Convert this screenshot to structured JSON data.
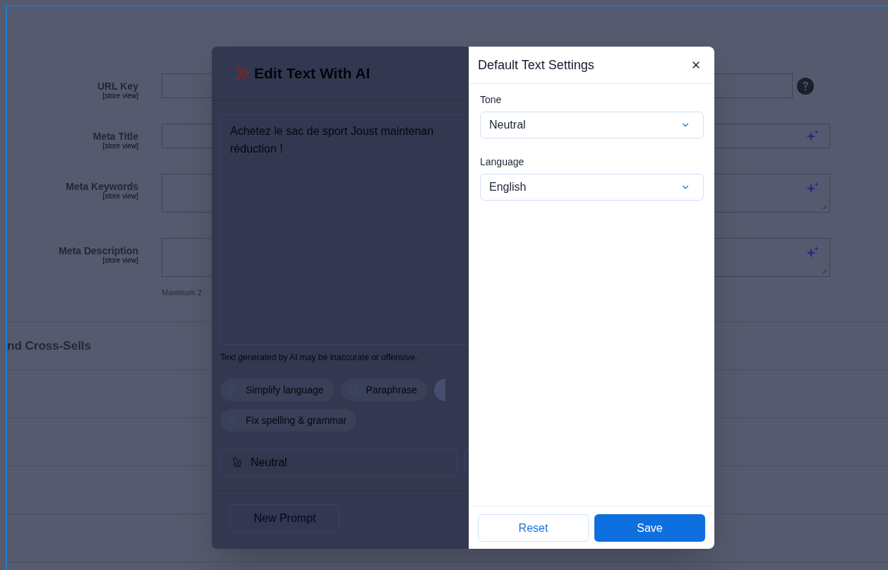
{
  "page": {
    "fields": [
      {
        "label": "URL Key",
        "scope": "[store view]",
        "kind": "input-help"
      },
      {
        "label": "Meta Title",
        "scope": "[store view]",
        "kind": "input-ai"
      },
      {
        "label": "Meta Keywords",
        "scope": "[store view]",
        "kind": "textarea-ai"
      },
      {
        "label": "Meta Description",
        "scope": "[store view]",
        "kind": "textarea-ai"
      }
    ],
    "note": "Maximum 2",
    "section_title": "nd Cross-Sells"
  },
  "ai_modal": {
    "title": "Edit Text With AI",
    "text_lines": [
      "Achetez le sac de sport Joust maintenan",
      "réduction !"
    ],
    "disclaimer": "Text generated by AI may be inaccurate or offensive.",
    "actions": [
      {
        "label": "Simplify language",
        "kind": "simplify"
      },
      {
        "label": "Paraphrase",
        "kind": "paraphrase"
      },
      {
        "kind": "hidden"
      },
      {
        "label": "Fix spelling & grammar",
        "kind": "spelling"
      }
    ],
    "tone": "Neutral",
    "new_prompt": "New Prompt"
  },
  "settings": {
    "title": "Default Text Settings",
    "fields": [
      {
        "label": "Tone",
        "value": "Neutral"
      },
      {
        "label": "Language",
        "value": "English"
      }
    ],
    "buttons": [
      {
        "label": "Reset",
        "kind": "secondary"
      },
      {
        "label": "Save",
        "kind": "primary"
      }
    ]
  }
}
